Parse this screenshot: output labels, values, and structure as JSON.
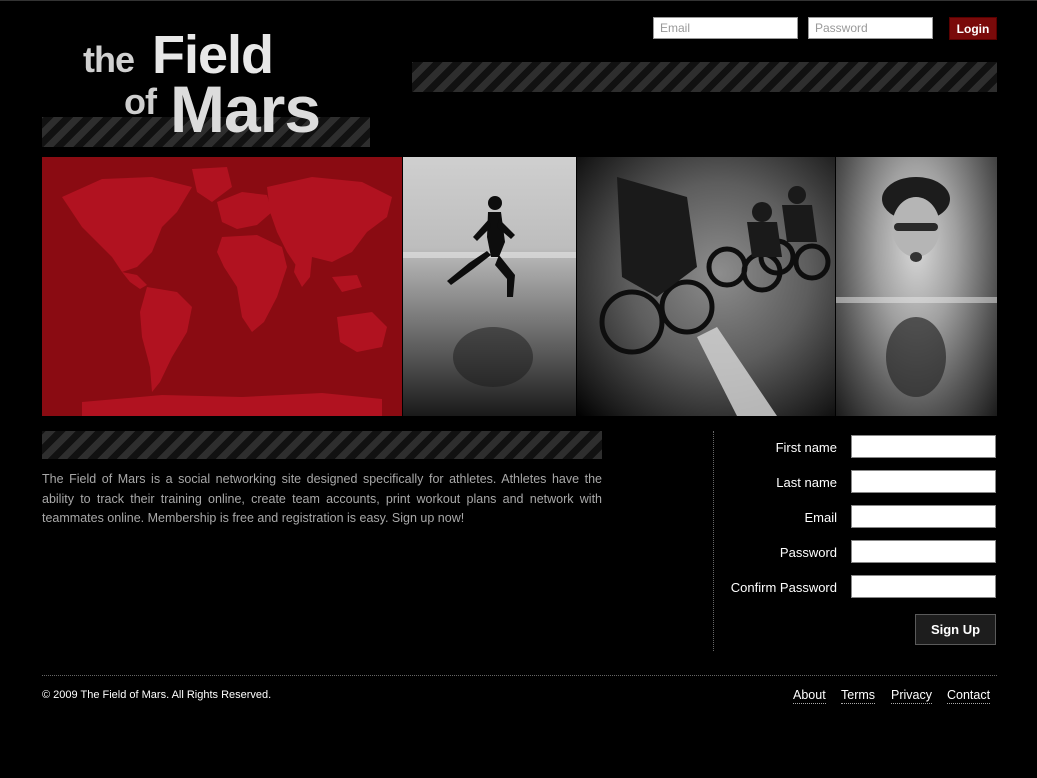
{
  "header": {
    "email_placeholder": "Email",
    "password_placeholder": "Password",
    "login_label": "Login"
  },
  "logo": {
    "the": "the",
    "field": "Field",
    "of": "of",
    "mars": "Mars"
  },
  "banner": {
    "panels": [
      "world-map",
      "runner-on-beach",
      "cyclists-racing",
      "swimmer-butterfly"
    ]
  },
  "about": {
    "text": "The Field of Mars is a social networking site designed specifically for athletes. Athletes have the ability to track their training online, create team accounts, print workout plans and network with teammates online. Membership is free and registration is easy. Sign up now!"
  },
  "signup": {
    "fields": [
      {
        "label": "First name"
      },
      {
        "label": "Last name"
      },
      {
        "label": "Email"
      },
      {
        "label": "Password"
      },
      {
        "label": "Confirm Password"
      }
    ],
    "button_label": "Sign Up"
  },
  "footer": {
    "copyright": "© 2009 The Field of Mars. All Rights Reserved.",
    "links": [
      "About",
      "Terms",
      "Privacy",
      "Contact"
    ]
  },
  "colors": {
    "background": "#000000",
    "accent_red": "#8a0b12",
    "login_button": "#7a0a0a"
  }
}
